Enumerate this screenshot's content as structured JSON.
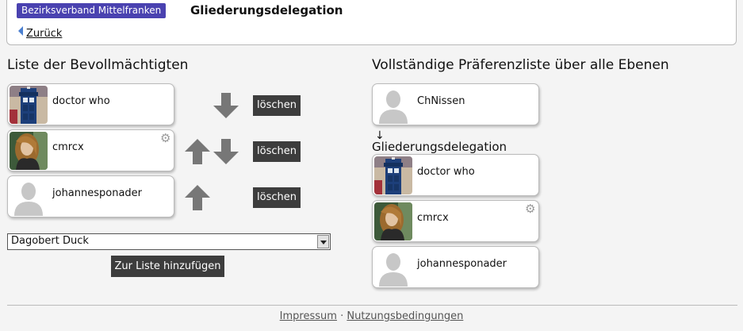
{
  "header": {
    "unit_badge": "Bezirksverband Mittelfranken",
    "area_title": "Gliederungsdelegation",
    "back_label": "Zurück"
  },
  "left": {
    "title": "Liste der Bevollmächtigten",
    "members": [
      {
        "name": "doctor who",
        "avatar": "tardis",
        "has_gear": false,
        "arrows": [
          "down"
        ],
        "delete_label": "löschen"
      },
      {
        "name": "cmrcx",
        "avatar": "portrait",
        "has_gear": true,
        "arrows": [
          "up",
          "down"
        ],
        "delete_label": "löschen"
      },
      {
        "name": "johannesponader",
        "avatar": "placeholder",
        "has_gear": false,
        "arrows": [
          "up"
        ],
        "delete_label": "löschen"
      }
    ],
    "select": {
      "selected": "Dagobert Duck"
    },
    "add_button_label": "Zur Liste hinzufügen"
  },
  "right": {
    "title": "Vollständige Präferenzliste über alle Ebenen",
    "top_member": {
      "name": "ChNissen",
      "avatar": "placeholder"
    },
    "down_arrow_glyph": "↓",
    "area_label": "Gliederungsdelegation",
    "members": [
      {
        "name": "doctor who",
        "avatar": "tardis",
        "has_gear": false
      },
      {
        "name": "cmrcx",
        "avatar": "portrait",
        "has_gear": true
      },
      {
        "name": "johannesponader",
        "avatar": "placeholder",
        "has_gear": false
      }
    ]
  },
  "footer": {
    "impressum": "Impressum",
    "separator": "·",
    "terms": "Nutzungsbedingungen"
  },
  "icons": {
    "gear": "gear-icon",
    "arrow_up": "arrow-up-icon",
    "arrow_down": "arrow-down-icon",
    "back": "triangle-left-icon"
  },
  "colors": {
    "badge": "#4a42b0",
    "button_bg": "#3d3d3d",
    "arrow": "#777777"
  }
}
